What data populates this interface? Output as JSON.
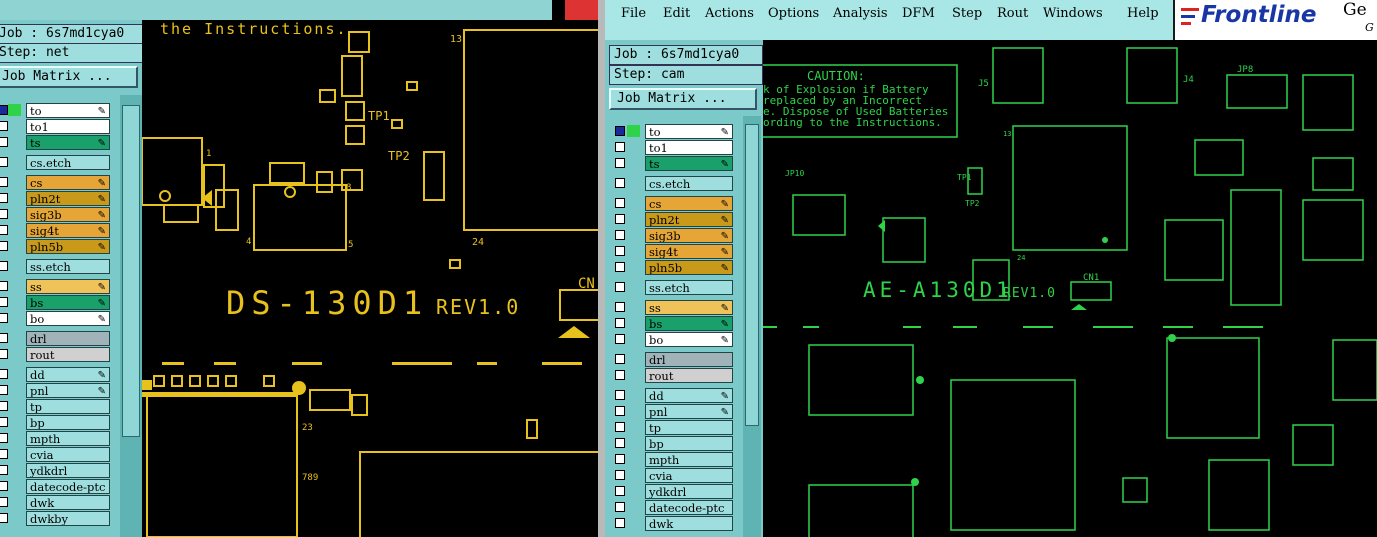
{
  "left_window": {
    "job_label": "Job : 6s7md1cya0",
    "step_label": "Step: net",
    "job_matrix_button": "Job Matrix ...",
    "layers": [
      {
        "name": "to",
        "color": "#ffffff",
        "icon": "pencil-icon",
        "active_marker": true
      },
      {
        "name": "to1",
        "color": "#ffffff"
      },
      {
        "name": "ts",
        "color": "#1aa06a",
        "icon": "pencil-icon"
      },
      {
        "name": "cs.etch",
        "color": "#9fdede"
      },
      {
        "name": "cs",
        "color": "#e5a637",
        "icon": "pencil-icon"
      },
      {
        "name": "pln2t",
        "color": "#c99a1a",
        "icon": "pencil-icon"
      },
      {
        "name": "sig3b",
        "color": "#e5a637",
        "icon": "pencil-icon"
      },
      {
        "name": "sig4t",
        "color": "#e5a637",
        "icon": "pencil-icon"
      },
      {
        "name": "pln5b",
        "color": "#c99a1a",
        "icon": "pencil-icon"
      },
      {
        "name": "ss.etch",
        "color": "#9fdede"
      },
      {
        "name": "ss",
        "color": "#f0c25a",
        "icon": "pencil-icon"
      },
      {
        "name": "bs",
        "color": "#1aa06a",
        "icon": "pencil-icon"
      },
      {
        "name": "bo",
        "color": "#ffffff",
        "icon": "pencil-icon"
      },
      {
        "name": "drl",
        "color": "#9fb3b8"
      },
      {
        "name": "rout",
        "color": "#d0d0d0"
      },
      {
        "name": "dd",
        "color": "#9fdede",
        "icon": "pencil-icon"
      },
      {
        "name": "pnl",
        "color": "#9fdede",
        "icon": "pencil-icon"
      },
      {
        "name": "tp",
        "color": "#9fdede"
      },
      {
        "name": "bp",
        "color": "#9fdede"
      },
      {
        "name": "mpth",
        "color": "#9fdede"
      },
      {
        "name": "cvia",
        "color": "#9fdede"
      },
      {
        "name": "ydkdrl",
        "color": "#9fdede"
      },
      {
        "name": "datecode-ptc",
        "color": "#9fdede"
      },
      {
        "name": "dwk",
        "color": "#9fdede"
      },
      {
        "name": "dwkby",
        "color": "#9fdede"
      }
    ],
    "board_text": {
      "instructions": "the Instructions.",
      "title": "DS-130D1",
      "rev": "REV1.0",
      "cn": "CN",
      "tp1": "TP1",
      "tp2": "TP2",
      "n13": "13",
      "n24": "24",
      "n1": "1",
      "n4": "4",
      "n5": "5",
      "n8": "8",
      "n23": "23",
      "n789": "789"
    }
  },
  "right_window": {
    "menus": [
      {
        "label": "File"
      },
      {
        "label": "Edit"
      },
      {
        "label": "Actions"
      },
      {
        "label": "Options"
      },
      {
        "label": "Analysis"
      },
      {
        "label": "DFM"
      },
      {
        "label": "Step"
      },
      {
        "label": "Rout"
      },
      {
        "label": "Windows"
      },
      {
        "label": "Help"
      }
    ],
    "brand": "Frontline",
    "brand_suffix": "Ge",
    "brand_suffix2": "G",
    "job_label": "Job : 6s7md1cya0",
    "step_label": "Step: cam",
    "job_matrix_button": "Job Matrix ...",
    "layers": [
      {
        "name": "to",
        "color": "#ffffff",
        "icon": "pencil-icon",
        "active_marker": true
      },
      {
        "name": "to1",
        "color": "#ffffff"
      },
      {
        "name": "ts",
        "color": "#1aa06a",
        "icon": "pencil-icon"
      },
      {
        "name": "cs.etch",
        "color": "#9fdede"
      },
      {
        "name": "cs",
        "color": "#e5a637",
        "icon": "pencil-icon"
      },
      {
        "name": "pln2t",
        "color": "#c99a1a",
        "icon": "pencil-icon"
      },
      {
        "name": "sig3b",
        "color": "#e5a637",
        "icon": "pencil-icon"
      },
      {
        "name": "sig4t",
        "color": "#e5a637",
        "icon": "pencil-icon"
      },
      {
        "name": "pln5b",
        "color": "#c99a1a",
        "icon": "pencil-icon"
      },
      {
        "name": "ss.etch",
        "color": "#9fdede"
      },
      {
        "name": "ss",
        "color": "#f0c25a",
        "icon": "pencil-icon"
      },
      {
        "name": "bs",
        "color": "#1aa06a",
        "icon": "pencil-icon"
      },
      {
        "name": "bo",
        "color": "#ffffff",
        "icon": "pencil-icon"
      },
      {
        "name": "drl",
        "color": "#9fb3b8"
      },
      {
        "name": "rout",
        "color": "#d0d0d0"
      },
      {
        "name": "dd",
        "color": "#9fdede",
        "icon": "pencil-icon"
      },
      {
        "name": "pnl",
        "color": "#9fdede",
        "icon": "pencil-icon"
      },
      {
        "name": "tp",
        "color": "#9fdede"
      },
      {
        "name": "bp",
        "color": "#9fdede"
      },
      {
        "name": "mpth",
        "color": "#9fdede"
      },
      {
        "name": "cvia",
        "color": "#9fdede"
      },
      {
        "name": "ydkdrl",
        "color": "#9fdede"
      },
      {
        "name": "datecode-ptc",
        "color": "#9fdede"
      },
      {
        "name": "dwk",
        "color": "#9fdede"
      }
    ],
    "board_text": {
      "caution_title": "CAUTION:",
      "caution_lines": [
        "k of Explosion if Battery",
        "replaced by an Incorrect",
        "e. Dispose of Used Batteries",
        "ording to the Instructions."
      ],
      "title": "AE-A130D1",
      "rev": "REV1.0",
      "cn1": "CN1",
      "j5": "J5",
      "j4": "J4",
      "jp8": "JP8",
      "jp10": "JP10",
      "tp1": "TP1",
      "tp2": "TP2",
      "n13": "13",
      "n24": "24"
    }
  },
  "colors": {
    "pcb_yellow": "#e8c21c",
    "pcb_green": "#2fd34a",
    "panel_teal": "#7cc9c9"
  }
}
